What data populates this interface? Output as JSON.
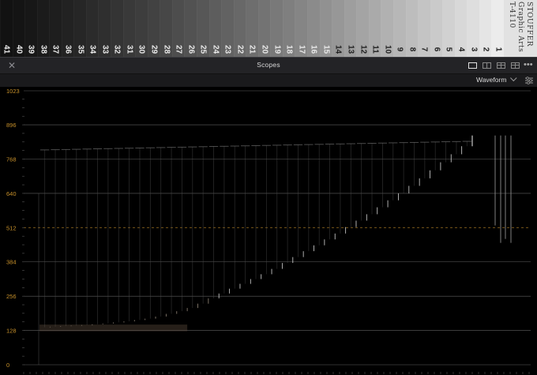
{
  "wedge": {
    "numbers": [
      "41",
      "40",
      "39",
      "38",
      "37",
      "36",
      "35",
      "34",
      "33",
      "32",
      "31",
      "30",
      "29",
      "28",
      "27",
      "26",
      "25",
      "24",
      "23",
      "22",
      "21",
      "20",
      "19",
      "18",
      "17",
      "16",
      "15",
      "14",
      "13",
      "12",
      "11",
      "10",
      "9",
      "8",
      "7",
      "6",
      "5",
      "4",
      "3",
      "2",
      "1"
    ],
    "brand_lines": [
      "STOUFFER",
      "Graphic Arts",
      "T-4110"
    ]
  },
  "header": {
    "close_icon": "close-icon",
    "title": "Scopes",
    "more_label": "•••"
  },
  "toolbar": {
    "scope_type": "Waveform",
    "settings_icon": "sliders-icon"
  },
  "chart_data": {
    "type": "waveform",
    "y_ticks": [
      0,
      128,
      256,
      384,
      512,
      640,
      768,
      896,
      1023
    ],
    "y_tick_labels": [
      "0",
      "128",
      "256",
      "384",
      "512",
      "640",
      "768",
      "896",
      "1023"
    ],
    "ylim": [
      0,
      1023
    ],
    "grid": true,
    "reference_line": {
      "value": 512,
      "style": "dashed"
    },
    "accent_color": "#c8912a",
    "steps": [
      {
        "step": 41,
        "level": 140
      },
      {
        "step": 40,
        "level": 142
      },
      {
        "step": 39,
        "level": 144
      },
      {
        "step": 38,
        "level": 146
      },
      {
        "step": 37,
        "level": 148
      },
      {
        "step": 36,
        "level": 151
      },
      {
        "step": 35,
        "level": 154
      },
      {
        "step": 34,
        "level": 158
      },
      {
        "step": 33,
        "level": 162
      },
      {
        "step": 32,
        "level": 167
      },
      {
        "step": 31,
        "level": 172
      },
      {
        "step": 30,
        "level": 180
      },
      {
        "step": 29,
        "level": 190
      },
      {
        "step": 28,
        "level": 200
      },
      {
        "step": 27,
        "level": 212
      },
      {
        "step": 26,
        "level": 228
      },
      {
        "step": 25,
        "level": 248
      },
      {
        "step": 24,
        "level": 266
      },
      {
        "step": 23,
        "level": 284
      },
      {
        "step": 22,
        "level": 302
      },
      {
        "step": 21,
        "level": 320
      },
      {
        "step": 20,
        "level": 338
      },
      {
        "step": 19,
        "level": 358
      },
      {
        "step": 18,
        "level": 380
      },
      {
        "step": 17,
        "level": 402
      },
      {
        "step": 16,
        "level": 424
      },
      {
        "step": 15,
        "level": 446
      },
      {
        "step": 14,
        "level": 468
      },
      {
        "step": 13,
        "level": 490
      },
      {
        "step": 12,
        "level": 514
      },
      {
        "step": 11,
        "level": 538
      },
      {
        "step": 10,
        "level": 562
      },
      {
        "step": 9,
        "level": 588
      },
      {
        "step": 8,
        "level": 614
      },
      {
        "step": 7,
        "level": 640
      },
      {
        "step": 6,
        "level": 668
      },
      {
        "step": 5,
        "level": 696
      },
      {
        "step": 4,
        "level": 726
      },
      {
        "step": 3,
        "level": 756
      },
      {
        "step": 2,
        "level": 786
      },
      {
        "step": 1,
        "level": 816
      }
    ],
    "paper_white_level": 856,
    "top_trace_level": 835
  }
}
